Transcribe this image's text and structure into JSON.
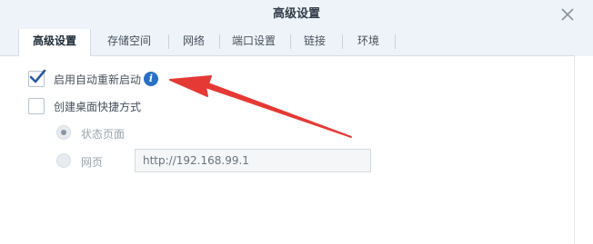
{
  "dialog": {
    "title": "高级设置"
  },
  "tabs": [
    {
      "label": "高级设置",
      "active": true
    },
    {
      "label": "存储空间",
      "active": false
    },
    {
      "label": "网络",
      "active": false
    },
    {
      "label": "端口设置",
      "active": false
    },
    {
      "label": "链接",
      "active": false
    },
    {
      "label": "环境",
      "active": false
    }
  ],
  "options": {
    "autorestart": {
      "label": "启用自动重新启动",
      "checked": true
    },
    "shortcut": {
      "label": "创建桌面快捷方式",
      "checked": false
    },
    "status_page": {
      "label": "状态页面",
      "selected": true,
      "disabled": true
    },
    "webpage": {
      "label": "网页",
      "selected": false,
      "disabled": true
    }
  },
  "url_field": {
    "value": "http://192.168.99.1"
  },
  "colors": {
    "accent": "#2a6fc4",
    "arrow": "#e53935",
    "header_bg": "#eef3f9"
  },
  "icons": {
    "close": "close-icon",
    "info": "info-icon",
    "check": "check-icon"
  }
}
